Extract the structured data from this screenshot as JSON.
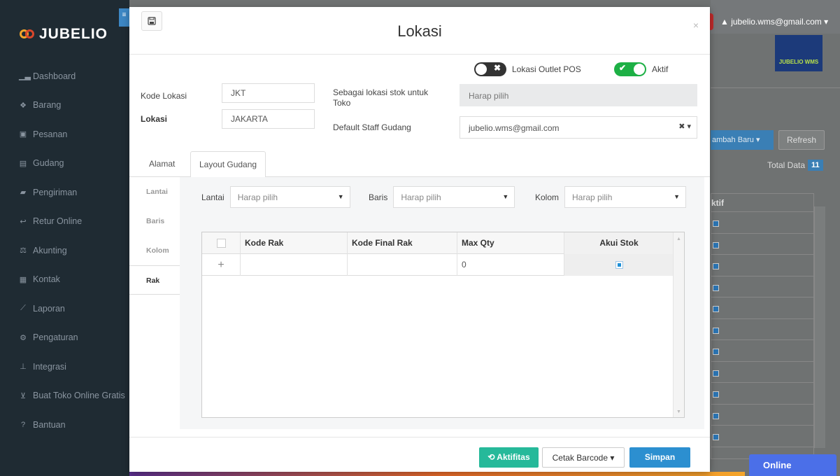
{
  "app": {
    "logo_text": "JUBELIO"
  },
  "sidebar": {
    "items": [
      {
        "label": "Dashboard",
        "icon": "chart-area-icon",
        "glyph": "▁▃"
      },
      {
        "label": "Barang",
        "icon": "cubes-icon",
        "glyph": "❖"
      },
      {
        "label": "Pesanan",
        "icon": "gift-icon",
        "glyph": "▣"
      },
      {
        "label": "Gudang",
        "icon": "building-icon",
        "glyph": "▤"
      },
      {
        "label": "Pengiriman",
        "icon": "truck-icon",
        "glyph": "▰"
      },
      {
        "label": "Retur Online",
        "icon": "reply-icon",
        "glyph": "↩"
      },
      {
        "label": "Akunting",
        "icon": "balance-scale-icon",
        "glyph": "⚖"
      },
      {
        "label": "Kontak",
        "icon": "address-card-icon",
        "glyph": "▦"
      },
      {
        "label": "Laporan",
        "icon": "line-chart-icon",
        "glyph": "⟋"
      },
      {
        "label": "Pengaturan",
        "icon": "cogs-icon",
        "glyph": "⚙"
      },
      {
        "label": "Integrasi",
        "icon": "sitemap-icon",
        "glyph": "⊥"
      },
      {
        "label": "Buat Toko Online Gratis",
        "icon": "cart-icon",
        "glyph": "⊻"
      },
      {
        "label": "Bantuan",
        "icon": "question-circle-icon",
        "glyph": "?"
      }
    ]
  },
  "topbar": {
    "user_email": "jubelio.wms@gmail.com",
    "wms_label": "JUBELIO WMS"
  },
  "background": {
    "add_button": "ambah Baru ▾",
    "refresh_button": "Refresh",
    "total_label": "Total Data",
    "total_count": "11",
    "table_header": "ktif",
    "online_button": "Online"
  },
  "modal": {
    "title": "Lokasi",
    "close_glyph": "×",
    "toggles": {
      "outlet_pos_label": "Lokasi Outlet POS",
      "outlet_pos_on": false,
      "aktif_label": "Aktif",
      "aktif_on": true
    },
    "form": {
      "kode_lokasi_label": "Kode Lokasi",
      "kode_lokasi_value": "JKT",
      "lokasi_label": "Lokasi",
      "lokasi_value": "JAKARTA",
      "stok_toko_label": "Sebagai lokasi stok untuk Toko",
      "stok_toko_placeholder": "Harap pilih",
      "staff_label": "Default Staff Gudang",
      "staff_value": "jubelio.wms@gmail.com"
    },
    "tabs": [
      {
        "label": "Alamat",
        "active": false
      },
      {
        "label": "Layout Gudang",
        "active": true
      }
    ],
    "subnav": [
      {
        "label": "Lantai",
        "active": false
      },
      {
        "label": "Baris",
        "active": false
      },
      {
        "label": "Kolom",
        "active": false
      },
      {
        "label": "Rak",
        "active": true
      }
    ],
    "filters": {
      "lantai_label": "Lantai",
      "lantai_placeholder": "Harap pilih",
      "baris_label": "Baris",
      "baris_placeholder": "Harap pilih",
      "kolom_label": "Kolom",
      "kolom_placeholder": "Harap pilih"
    },
    "grid": {
      "columns": [
        "Kode Rak",
        "Kode Final Rak",
        "Max Qty",
        "Akui Stok"
      ],
      "add_row_glyph": "+",
      "new_row": {
        "kode_rak": "",
        "kode_final_rak": "",
        "max_qty": "0",
        "akui_stok": true
      }
    },
    "footer": {
      "aktifitas_label": "Aktifitas",
      "cetak_barcode_label": "Cetak Barcode",
      "simpan_label": "Simpan"
    }
  },
  "colors": {
    "sidebar_bg": "#1f2b33",
    "toggle_on": "#1db045",
    "teal_button": "#26b99a",
    "primary_button": "#2c8fd0"
  }
}
